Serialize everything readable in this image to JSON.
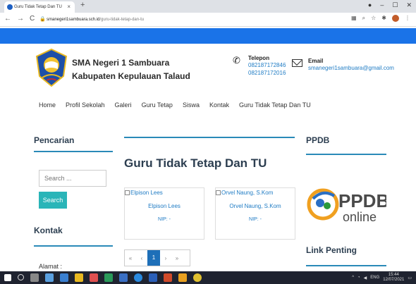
{
  "browser": {
    "tab_title": "Guru Tidak Tetap Dan TU",
    "tab_close": "×",
    "new_tab": "+",
    "url_host": "smanegeri1sambuara.sch.id",
    "url_path": "/guru-tidak-tetap-dan-tu",
    "window_minimize": "–",
    "window_maximize": "☐",
    "window_close": "✕"
  },
  "header": {
    "school_line1": "SMA Negeri 1 Sambuara",
    "school_line2": "Kabupaten Kepulauan Talaud",
    "phone_label": "Telepon",
    "phone1": "082187172846",
    "phone2": "082187172016",
    "email_label": "Email",
    "email": "smanegeri1sambuara@gmail.com"
  },
  "nav": {
    "items": [
      "Home",
      "Profil Sekolah",
      "Galeri",
      "Guru Tetap",
      "Siswa",
      "Kontak",
      "Guru Tidak Tetap Dan TU"
    ]
  },
  "sidebar_left": {
    "search_title": "Pencarian",
    "search_placeholder": "Search ...",
    "search_button": "Search",
    "kontak_title": "Kontak",
    "alamat": "Alamat :"
  },
  "main": {
    "title": "Guru Tidak Tetap Dan TU",
    "cards": [
      {
        "img_alt": "Elpison Lees",
        "name": "Elpison Lees",
        "nip": "NIP: -"
      },
      {
        "img_alt": "Orvel Naung, S.Kom",
        "name": "Orvel Naung, S.Kom",
        "nip": "NIP: -"
      }
    ],
    "pagination": {
      "first": "«",
      "prev": "‹",
      "current": "1",
      "next": "›",
      "last": "»"
    }
  },
  "sidebar_right": {
    "ppdb_title": "PPDB",
    "ppdb_logo_text": "PPDB",
    "ppdb_logo_sub": "online",
    "link_title": "Link Penting"
  },
  "taskbar": {
    "time": "15:44",
    "date": "12/07/2021",
    "lang": "ENG"
  },
  "colors": {
    "accent_bar": "#1a73e8",
    "widget_line": "#2a8ab8",
    "search_button": "#2ab5b8",
    "link": "#1e7bc4"
  }
}
